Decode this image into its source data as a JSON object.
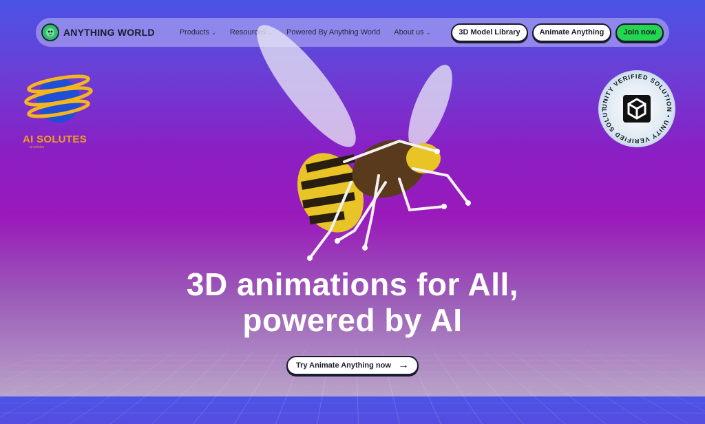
{
  "brand": {
    "name": "ANYTHING WORLD",
    "logo_icon": "alien-face-icon"
  },
  "nav": {
    "links": [
      {
        "label": "Products",
        "has_dropdown": true
      },
      {
        "label": "Resources",
        "has_dropdown": true
      },
      {
        "label": "Powered By Anything World",
        "has_dropdown": false
      },
      {
        "label": "About us",
        "has_dropdown": true
      }
    ],
    "buttons": {
      "model_library": "3D Model Library",
      "animate": "Animate Anything",
      "join": "Join now"
    }
  },
  "watermark": {
    "title": "AI SOLUTES",
    "subtitle": "ai solutes"
  },
  "badge": {
    "text": "UNITY VERIFIED SOLUTION • UNITY VERIFIED SOLUTION •"
  },
  "hero": {
    "line1": "3D animations for All,",
    "line2": "powered by AI",
    "cta_label": "Try Animate Anything now",
    "cta_icon": "arrow-right-icon"
  },
  "colors": {
    "join_green": "#22d650",
    "watermark_orange": "#f2a11c",
    "bee_yellow": "#e8c427"
  }
}
